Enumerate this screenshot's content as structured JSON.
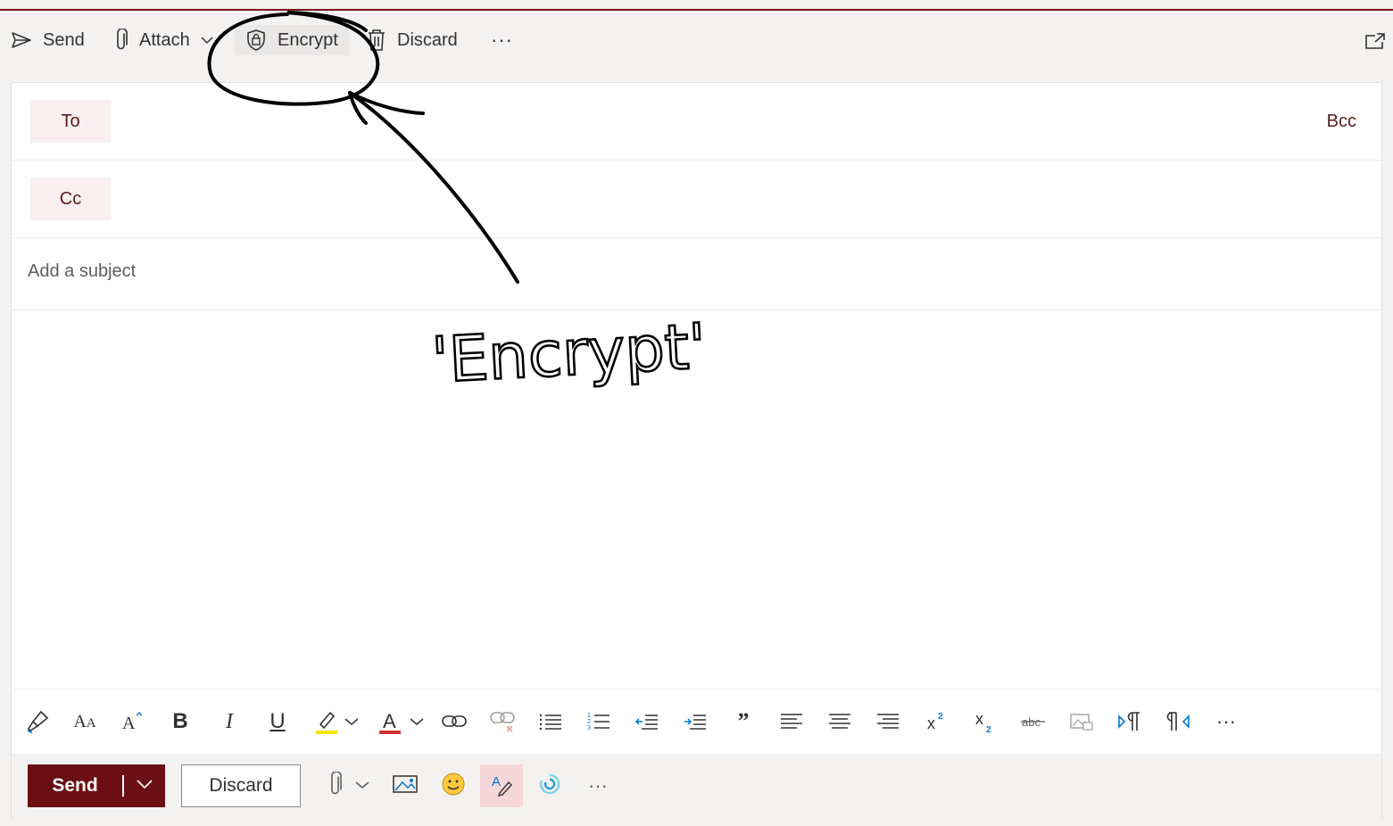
{
  "command_bar": {
    "send_label": "Send",
    "attach_label": "Attach",
    "encrypt_label": "Encrypt",
    "discard_label": "Discard",
    "more_label": "···"
  },
  "recipients": {
    "to_label": "To",
    "cc_label": "Cc",
    "bcc_label": "Bcc"
  },
  "subject": {
    "placeholder": "Add a subject"
  },
  "format_toolbar": {
    "icons": [
      "format-painter-icon",
      "font-size-icon",
      "grow-font-icon",
      "bold-icon",
      "italic-icon",
      "underline-icon",
      "highlight-icon",
      "font-color-icon",
      "link-icon",
      "unlink-icon",
      "bullets-icon",
      "numbering-icon",
      "decrease-indent-icon",
      "increase-indent-icon",
      "quote-icon",
      "align-left-icon",
      "align-center-icon",
      "align-right-icon",
      "superscript-icon",
      "subscript-icon",
      "strikethrough-icon",
      "picture-inline-icon",
      "ltr-icon",
      "rtl-icon",
      "more-icon"
    ],
    "highlight_color": "#f2e600",
    "font_color": "#d13438"
  },
  "action_bar": {
    "send_label": "Send",
    "discard_label": "Discard",
    "more_label": "···"
  },
  "annotation": {
    "text": "'Encrypt'"
  },
  "colors": {
    "brand": "#6b0f14",
    "recipient_chip_bg": "#f9eff0",
    "accent_text": "#5b1a1a"
  }
}
